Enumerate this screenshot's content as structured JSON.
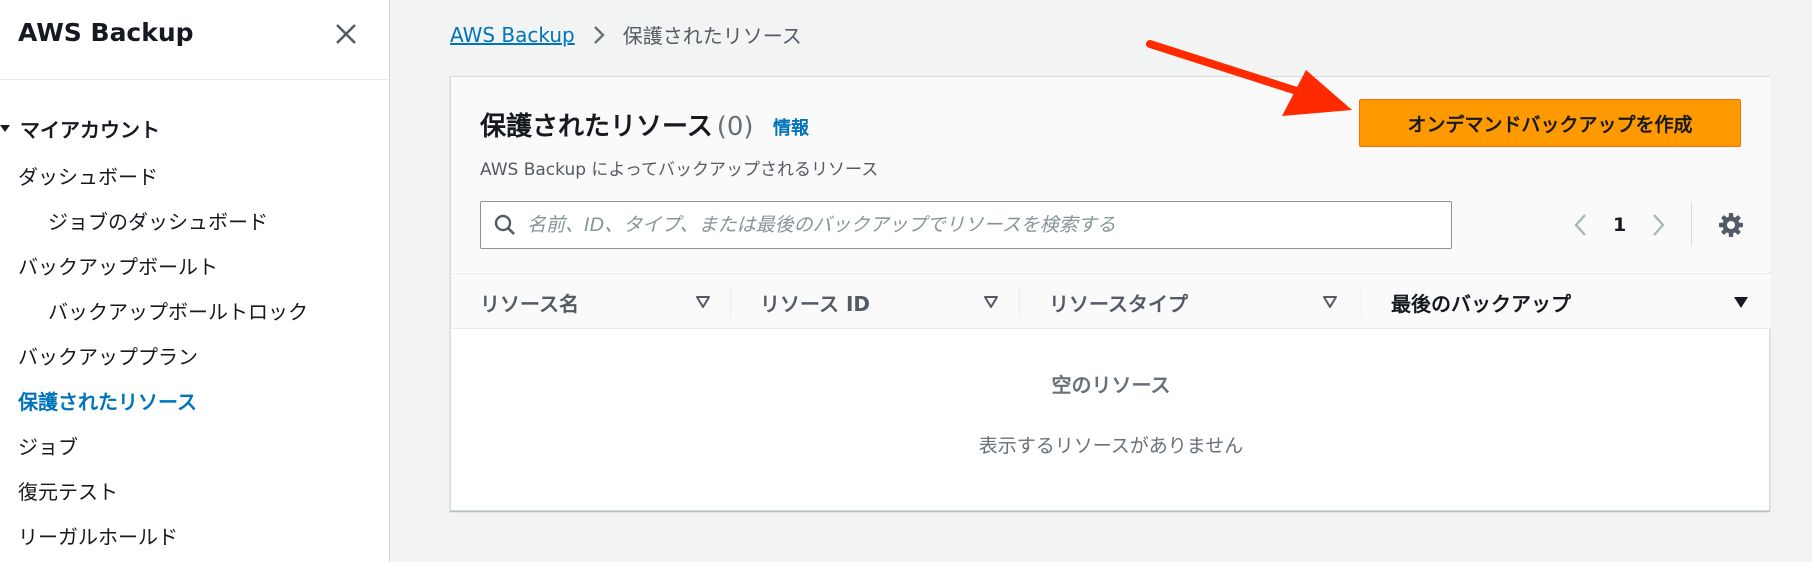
{
  "sidebar": {
    "title": "AWS Backup",
    "section": "マイアカウント",
    "items": [
      {
        "label": "ダッシュボード"
      },
      {
        "label": "ジョブのダッシュボード"
      },
      {
        "label": "バックアップボールト"
      },
      {
        "label": "バックアップボールトロック"
      },
      {
        "label": "バックアッププラン"
      },
      {
        "label": "保護されたリソース"
      },
      {
        "label": "ジョブ"
      },
      {
        "label": "復元テスト"
      },
      {
        "label": "リーガルホールド"
      }
    ],
    "active_item": "保護されたリソース"
  },
  "breadcrumb": {
    "root": "AWS Backup",
    "current": "保護されたリソース"
  },
  "panel": {
    "title": "保護されたリソース",
    "count": "(0)",
    "info_link": "情報",
    "description": "AWS Backup によってバックアップされるリソース",
    "create_button": "オンデマンドバックアップを作成",
    "search_placeholder": "名前、ID、タイプ、または最後のバックアップでリソースを検索する",
    "page_number": "1",
    "columns": [
      {
        "label": "リソース名"
      },
      {
        "label": "リソース ID"
      },
      {
        "label": "リソースタイプ"
      },
      {
        "label": "最後のバックアップ"
      }
    ],
    "empty_title": "空のリソース",
    "empty_desc": "表示するリソースがありません"
  },
  "colors": {
    "accent": "#ff9900",
    "link": "#0073bb",
    "annotation_arrow": "#ff2a00"
  },
  "icons": [
    "close-icon",
    "caret-down-icon",
    "chevron-right-icon",
    "search-icon",
    "chevron-left-icon",
    "gear-icon",
    "sort-icon"
  ]
}
